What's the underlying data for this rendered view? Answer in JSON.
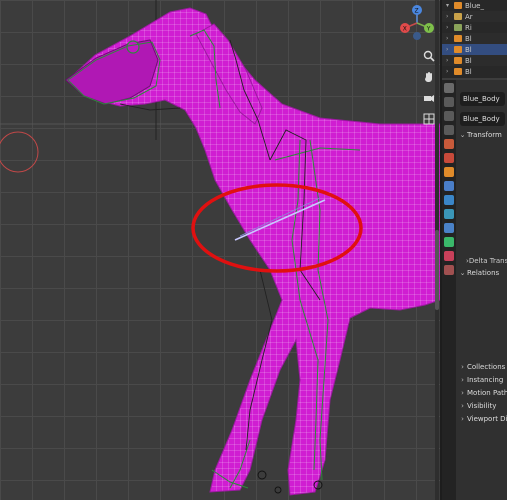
{
  "outliner": {
    "rows": [
      {
        "label": "Blue_",
        "tw": "▾",
        "icon_color": "#e08b2a",
        "selected": false
      },
      {
        "label": "Ar",
        "tw": "›",
        "icon_color": "#c9a24a",
        "selected": false
      },
      {
        "label": "Ri",
        "tw": "›",
        "icon_color": "#8aa35a",
        "selected": false
      },
      {
        "label": "Bl",
        "tw": "›",
        "icon_color": "#e08b2a",
        "selected": false
      },
      {
        "label": "Bl",
        "tw": "›",
        "icon_color": "#e08b2a",
        "selected": true
      },
      {
        "label": "Bl",
        "tw": "›",
        "icon_color": "#e08b2a",
        "selected": false
      },
      {
        "label": "Bl",
        "tw": "›",
        "icon_color": "#e08b2a",
        "selected": false
      }
    ]
  },
  "properties": {
    "object_name": "Blue_Body",
    "mesh_name": "Blue_Body",
    "sections": {
      "transform": "Transform",
      "delta_transform": "Delta Transf",
      "relations": "Relations",
      "collections": "Collections",
      "instancing": "Instancing",
      "motion_paths": "Motion Paths",
      "visibility": "Visibility",
      "viewport_display": "Viewport Displ"
    }
  },
  "viewport": {
    "mesh_color": "#d01ed2",
    "highlight_color": "#e01010"
  },
  "gizmo": {
    "x_label": "X",
    "y_label": "Y",
    "z_label": "Z"
  }
}
